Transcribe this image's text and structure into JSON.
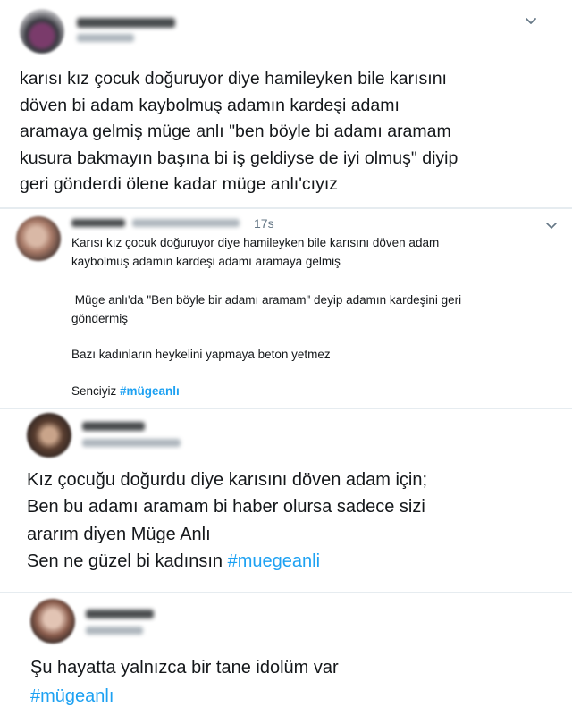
{
  "tweets": [
    {
      "text": "karısı kız çocuk doğuruyor diye hamileyken bile karısını\ndöven bi adam kaybolmuş adamın kardeşi adamı\naramaya gelmiş müge anlı \"ben böyle bi adamı aramam\nkusura bakmayın başına bi iş geldiyse de iyi olmuş\" diyip\ngeri gönderdi ölene kadar müge anlı'cıyız"
    },
    {
      "time": "17s",
      "line1": "Karısı kız çocuk doğuruyor diye hamileyken bile karısını döven adam",
      "line2": "kaybolmuş adamın kardeşi adamı aramaya gelmiş",
      "line3": " Müge anlı'da \"Ben böyle bir adamı aramam\" deyip adamın kardeşini geri",
      "line4": "göndermiş",
      "line5": "Bazı kadınların heykelini yapmaya beton yetmez",
      "line6_prefix": "Senciyiz ",
      "line6_hashtag": "#mügeanlı"
    },
    {
      "line1": "Kız çocuğu doğurdu diye karısını döven adam için;",
      "line2": "Ben bu adamı aramam bi haber olursa sadece sizi",
      "line3": "ararım diyen Müge Anlı",
      "line4_prefix": "Sen ne güzel bi kadınsın ",
      "line4_hashtag": "#muegeanli"
    },
    {
      "line1": "Şu hayatta yalnızca bir tane idolüm var",
      "line2_hashtag": "#mügeanlı"
    }
  ],
  "icons": {
    "chevron": "chevron-down-icon"
  },
  "colors": {
    "text": "#14171a",
    "hashtag": "#1da1f2",
    "muted": "#657786"
  }
}
